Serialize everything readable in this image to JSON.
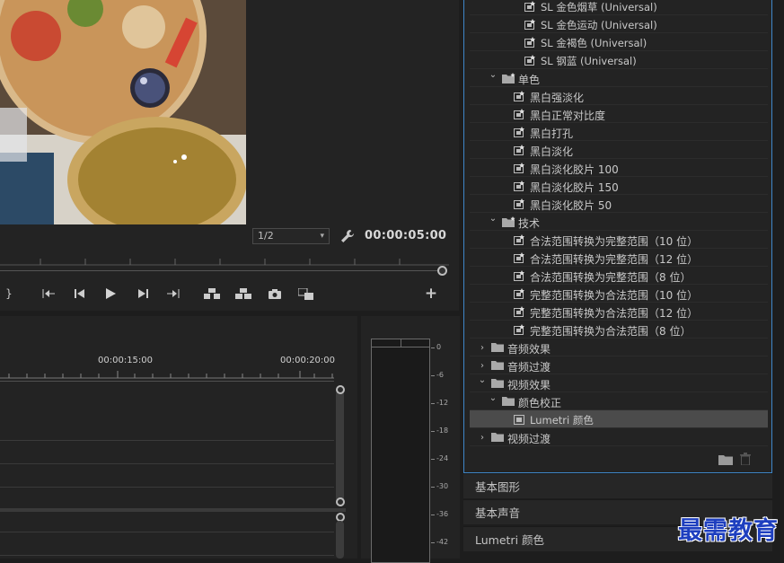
{
  "monitor": {
    "resolution": "1/2",
    "timecode": "00:00:05:00"
  },
  "timeline": {
    "tc1": "00:00:15:00",
    "tc2": "00:00:20:00"
  },
  "meter": {
    "db_labels": [
      "0",
      "-6",
      "-12",
      "-18",
      "-24",
      "-30",
      "-36",
      "-42"
    ]
  },
  "effects": {
    "items": [
      {
        "label": "SL 金色烟草 (Universal)",
        "kind": "preset"
      },
      {
        "label": "SL 金色运动 (Universal)",
        "kind": "preset"
      },
      {
        "label": "SL 金褐色 (Universal)",
        "kind": "preset"
      },
      {
        "label": "SL 钢蓝 (Universal)",
        "kind": "preset"
      },
      {
        "label": "单色",
        "kind": "preset-folder"
      },
      {
        "label": "黑白强淡化",
        "kind": "preset"
      },
      {
        "label": "黑白正常对比度",
        "kind": "preset"
      },
      {
        "label": "黑白打孔",
        "kind": "preset"
      },
      {
        "label": "黑白淡化",
        "kind": "preset"
      },
      {
        "label": "黑白淡化胶片 100",
        "kind": "preset"
      },
      {
        "label": "黑白淡化胶片 150",
        "kind": "preset"
      },
      {
        "label": "黑白淡化胶片 50",
        "kind": "preset"
      },
      {
        "label": "技术",
        "kind": "preset-folder"
      },
      {
        "label": "合法范围转换为完整范围（10 位）",
        "kind": "preset"
      },
      {
        "label": "合法范围转换为完整范围（12 位）",
        "kind": "preset"
      },
      {
        "label": "合法范围转换为完整范围（8 位）",
        "kind": "preset"
      },
      {
        "label": "完整范围转换为合法范围（10 位）",
        "kind": "preset"
      },
      {
        "label": "完整范围转换为合法范围（12 位）",
        "kind": "preset"
      },
      {
        "label": "完整范围转换为合法范围（8 位）",
        "kind": "preset"
      },
      {
        "label": "音频效果",
        "kind": "folder"
      },
      {
        "label": "音频过渡",
        "kind": "folder"
      },
      {
        "label": "视频效果",
        "kind": "folder"
      },
      {
        "label": "颜色校正",
        "kind": "folder"
      },
      {
        "label": "Lumetri 颜色",
        "kind": "effect"
      },
      {
        "label": "视频过渡",
        "kind": "folder"
      }
    ]
  },
  "panels": {
    "essential_graphics": "基本图形",
    "essential_sound": "基本声音",
    "lumetri_color": "Lumetri 颜色"
  },
  "watermark": "最需教育",
  "colors": {
    "panel_bg": "#232323",
    "selection": "#4b4b4b",
    "focus_border": "#3f86c8",
    "watermark": "#1e3fbf"
  }
}
